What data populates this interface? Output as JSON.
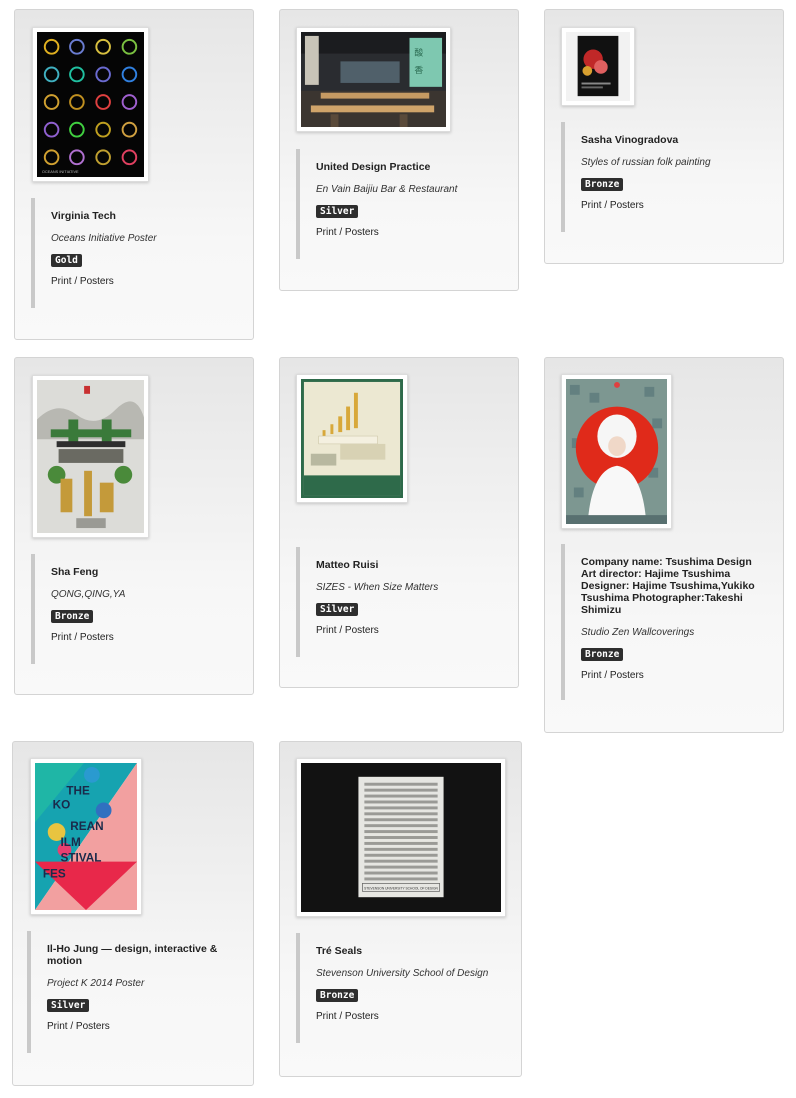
{
  "entries": [
    {
      "author": "Virginia Tech",
      "project": "Oceans Initiative Poster",
      "award": "Gold",
      "category": "Print / Posters",
      "image": "oceans-initiative-poster-thumbnail"
    },
    {
      "author": "United Design Practice",
      "project": "En Vain Baijiu Bar & Restaurant",
      "award": "Silver",
      "category": "Print / Posters",
      "image": "restaurant-interior-thumbnail"
    },
    {
      "author": "Sasha Vinogradova",
      "project": "Styles of russian folk painting",
      "award": "Bronze",
      "category": "Print / Posters",
      "image": "folk-painting-poster-thumbnail"
    },
    {
      "author": "Sha Feng",
      "project": "QONG,QING,YA",
      "award": "Bronze",
      "category": "Print / Posters",
      "image": "qong-qing-ya-poster-thumbnail"
    },
    {
      "author": "Matteo Ruisi",
      "project": "SIZES - When Size Matters",
      "award": "Silver",
      "category": "Print / Posters",
      "image": "sizes-poster-thumbnail"
    },
    {
      "author": "Company name: Tsushima Design Art director: Hajime Tsushima Designer: Hajime Tsushima,Yukiko Tsushima Photographer:Takeshi Shimizu",
      "project": "Studio Zen Wallcoverings",
      "award": "Bronze",
      "category": "Print / Posters",
      "image": "studio-zen-poster-thumbnail"
    },
    {
      "author": "Il-Ho Jung — design, interactive & motion",
      "project": "Project K 2014 Poster",
      "award": "Silver",
      "category": "Print / Posters",
      "image": "korean-film-festival-poster-thumbnail"
    },
    {
      "author": "Tré Seals",
      "project": "Stevenson University School of Design",
      "award": "Bronze",
      "category": "Print / Posters",
      "image": "type-poster-thumbnail"
    }
  ],
  "poster_text": {
    "oceans": "OCEANS INITIATIVE",
    "korean_lines": [
      "THE",
      "KO",
      "REAN",
      "ILM",
      "STIVAL",
      "FES"
    ],
    "seals_caption": "STEVENSON UNIVERSITY SCHOOL OF DESIGN"
  },
  "colors": {
    "badge_bg": "#2e2e2e",
    "card_border": "#d4d4d4",
    "accent_bar": "#c9c9c9"
  }
}
